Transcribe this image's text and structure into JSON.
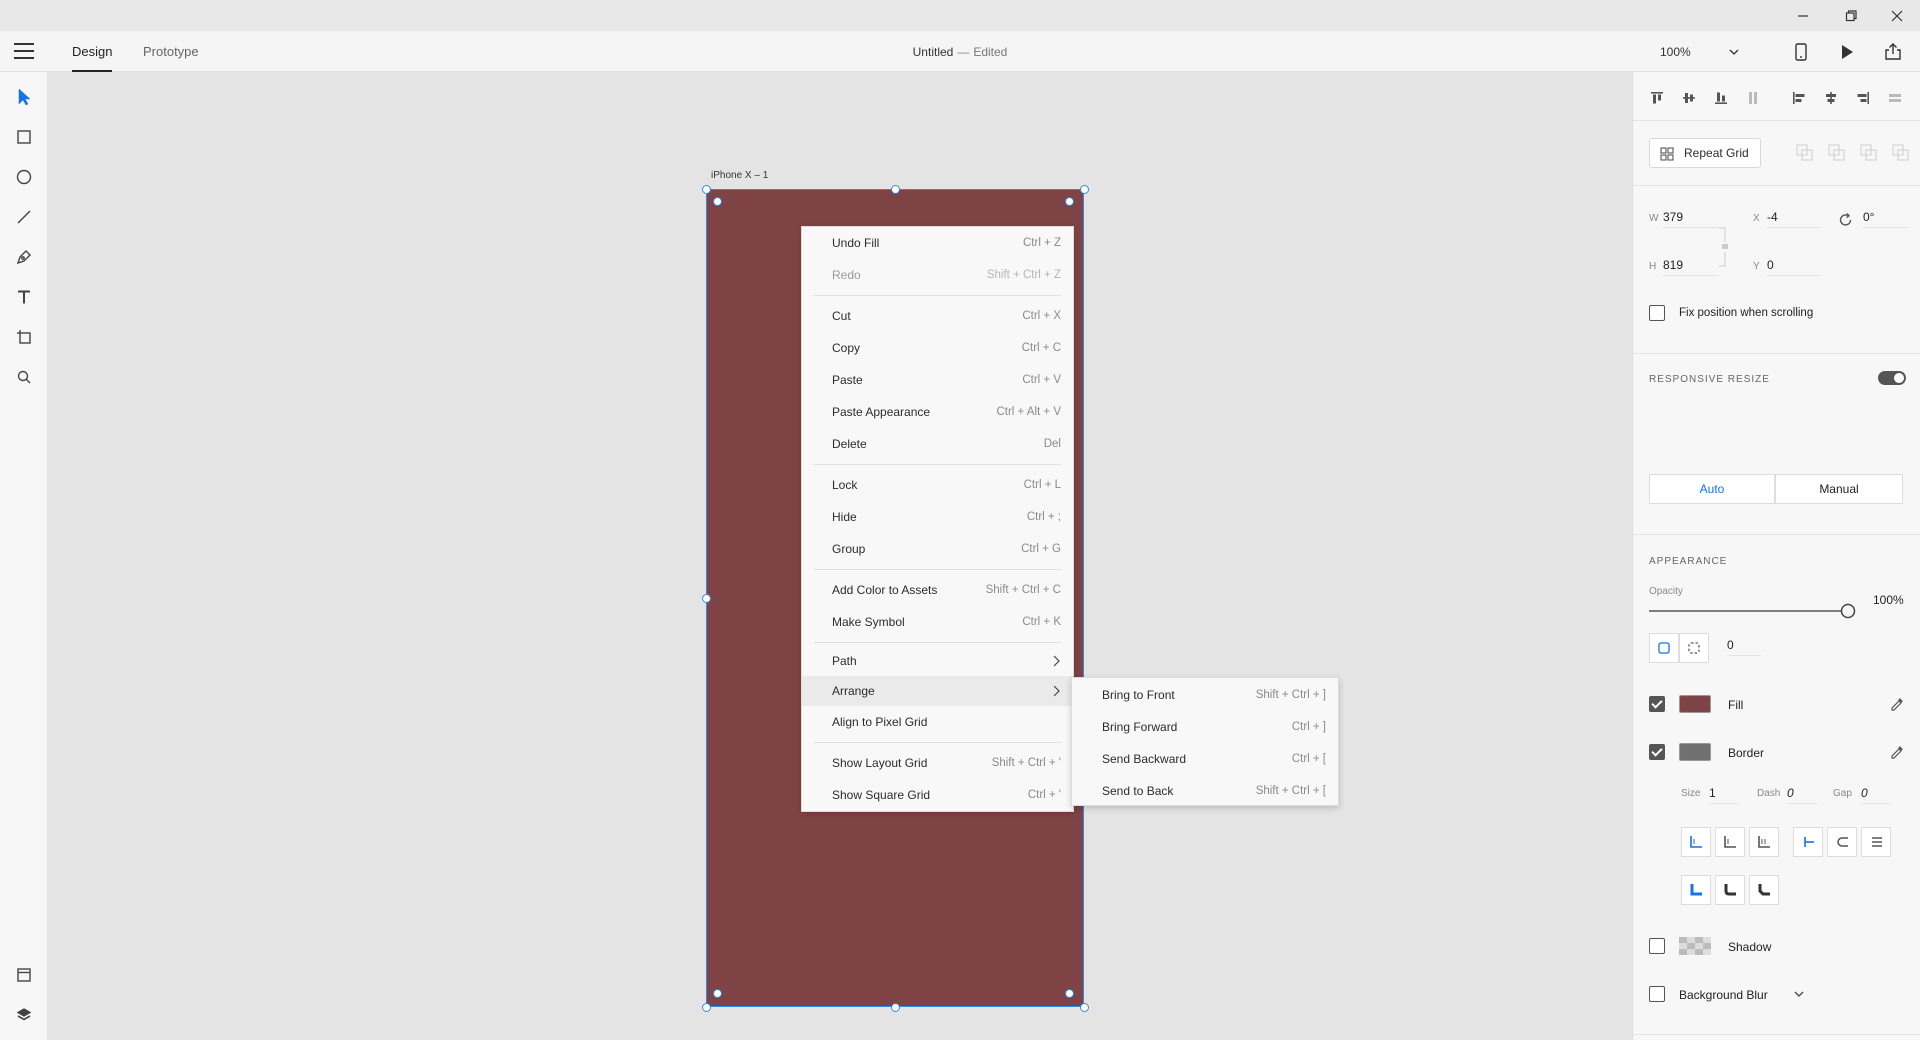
{
  "header": {
    "tabs": [
      {
        "label": "Design",
        "active": true
      },
      {
        "label": "Prototype",
        "active": false
      }
    ],
    "doc_title": "Untitled",
    "separator": "—",
    "doc_status": "Edited",
    "zoom": "100%"
  },
  "canvas": {
    "artboard_name": "iPhone X – 1",
    "artboard_fill": "#804345",
    "selection_color": "#2e8ce6"
  },
  "context_menu": {
    "items": [
      {
        "label": "Undo Fill",
        "shortcut": "Ctrl + Z"
      },
      {
        "label": "Redo",
        "shortcut": "Shift + Ctrl + Z",
        "disabled": true
      },
      {
        "label": "Cut",
        "shortcut": "Ctrl + X"
      },
      {
        "label": "Copy",
        "shortcut": "Ctrl + C"
      },
      {
        "label": "Paste",
        "shortcut": "Ctrl + V"
      },
      {
        "label": "Paste Appearance",
        "shortcut": "Ctrl + Alt + V"
      },
      {
        "label": "Delete",
        "shortcut": "Del"
      },
      {
        "label": "Lock",
        "shortcut": "Ctrl + L"
      },
      {
        "label": "Hide",
        "shortcut": "Ctrl + ;"
      },
      {
        "label": "Group",
        "shortcut": "Ctrl + G"
      },
      {
        "label": "Add Color to Assets",
        "shortcut": "Shift + Ctrl + C"
      },
      {
        "label": "Make Symbol",
        "shortcut": "Ctrl + K"
      },
      {
        "label": "Path",
        "submenu": true
      },
      {
        "label": "Arrange",
        "submenu": true,
        "highlighted": true
      },
      {
        "label": "Align to Pixel Grid"
      },
      {
        "label": "Show Layout Grid",
        "shortcut": "Shift + Ctrl + '"
      },
      {
        "label": "Show Square Grid",
        "shortcut": "Ctrl + '"
      }
    ]
  },
  "arrange_submenu": {
    "items": [
      {
        "label": "Bring to Front",
        "shortcut": "Shift + Ctrl + ]"
      },
      {
        "label": "Bring Forward",
        "shortcut": "Ctrl + ]"
      },
      {
        "label": "Send Backward",
        "shortcut": "Ctrl + ["
      },
      {
        "label": "Send to Back",
        "shortcut": "Shift + Ctrl + ["
      }
    ]
  },
  "panel": {
    "repeat_grid_label": "Repeat Grid",
    "w_label": "W",
    "w_value": "379",
    "h_label": "H",
    "h_value": "819",
    "x_label": "X",
    "x_value": "-4",
    "y_label": "Y",
    "y_value": "0",
    "rotation_value": "0°",
    "fix_position_label": "Fix position when scrolling",
    "responsive_resize_title": "RESPONSIVE RESIZE",
    "responsive_resize_on": true,
    "resize_modes": [
      "Auto",
      "Manual"
    ],
    "resize_mode_selected": "Auto",
    "appearance_title": "APPEARANCE",
    "opacity_label": "Opacity",
    "opacity_value": "100%",
    "opacity_level": 1.0,
    "corner_radius": "0",
    "fill_label": "Fill",
    "fill_checked": true,
    "fill_color": "#804345",
    "border_label": "Border",
    "border_checked": true,
    "border_color": "#707070",
    "size_label": "Size",
    "size_value": "1",
    "dash_label": "Dash",
    "dash_value": "0",
    "gap_label": "Gap",
    "gap_value": "0",
    "shadow_label": "Shadow",
    "shadow_checked": false,
    "bg_blur_label": "Background Blur",
    "bg_blur_checked": false,
    "accent_color": "#1473e6"
  }
}
